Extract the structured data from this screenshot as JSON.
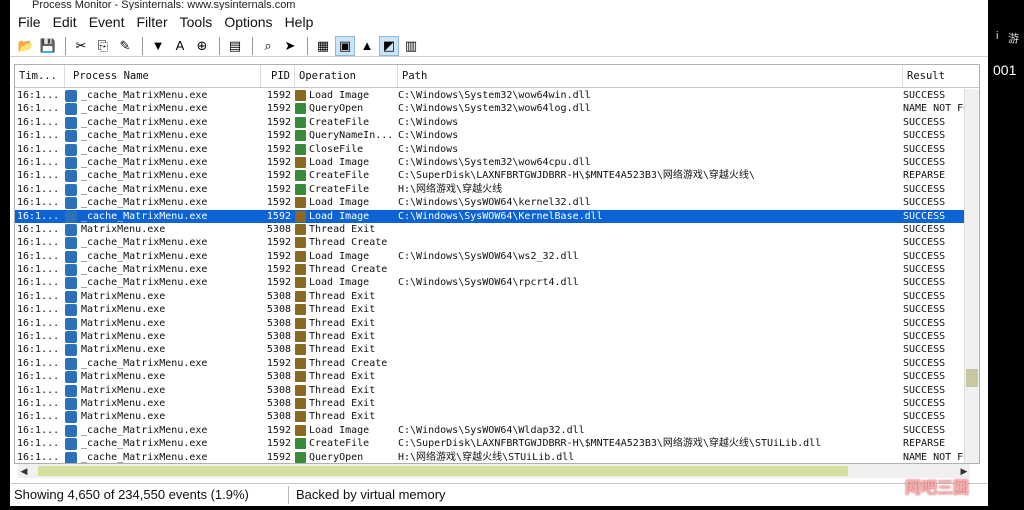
{
  "window": {
    "title": "Process Monitor - Sysinternals: www.sysinternals.com"
  },
  "menu": [
    "File",
    "Edit",
    "Event",
    "Filter",
    "Tools",
    "Options",
    "Help"
  ],
  "toolbar": {
    "buttons": [
      {
        "name": "open-icon",
        "glyph": "📂",
        "pressed": false
      },
      {
        "name": "save-icon",
        "glyph": "💾",
        "pressed": false
      },
      {
        "sep": true
      },
      {
        "name": "capture-icon",
        "glyph": "✂",
        "pressed": false
      },
      {
        "name": "autoscroll-icon",
        "glyph": "⎘",
        "pressed": false
      },
      {
        "name": "clear-icon",
        "glyph": "✎",
        "pressed": false
      },
      {
        "sep": true
      },
      {
        "name": "filter-icon",
        "glyph": "▼",
        "pressed": false
      },
      {
        "name": "highlight-icon",
        "glyph": "A",
        "pressed": false
      },
      {
        "name": "target-icon",
        "glyph": "⊕",
        "pressed": false
      },
      {
        "sep": true
      },
      {
        "name": "process-tree-icon",
        "glyph": "▤",
        "pressed": false
      },
      {
        "sep": true
      },
      {
        "name": "find-icon",
        "glyph": "⌕",
        "pressed": false
      },
      {
        "name": "jump-icon",
        "glyph": "➤",
        "pressed": false
      },
      {
        "sep": true
      },
      {
        "name": "registry-icon",
        "glyph": "▦",
        "pressed": false
      },
      {
        "name": "filesystem-icon",
        "glyph": "▣",
        "pressed": true
      },
      {
        "name": "network-icon",
        "glyph": "▲",
        "pressed": false
      },
      {
        "name": "process-thread-icon",
        "glyph": "◩",
        "pressed": true
      },
      {
        "name": "profiling-icon",
        "glyph": "▥",
        "pressed": false
      }
    ]
  },
  "columns": {
    "time": "Tim...",
    "process": "Process Name",
    "pid": "PID",
    "operation": "Operation",
    "path": "Path",
    "result": "Result"
  },
  "rows": [
    {
      "time": "16:1...",
      "process": "_cache_MatrixMenu.exe",
      "pid": "1592",
      "op": "Load Image",
      "cat": "proc",
      "path": "C:\\Windows\\System32\\wow64win.dll",
      "result": "SUCCESS"
    },
    {
      "time": "16:1...",
      "process": "_cache_MatrixMenu.exe",
      "pid": "1592",
      "op": "QueryOpen",
      "cat": "file",
      "path": "C:\\Windows\\System32\\wow64log.dll",
      "result": "NAME NOT FO"
    },
    {
      "time": "16:1...",
      "process": "_cache_MatrixMenu.exe",
      "pid": "1592",
      "op": "CreateFile",
      "cat": "file",
      "path": "C:\\Windows",
      "result": "SUCCESS"
    },
    {
      "time": "16:1...",
      "process": "_cache_MatrixMenu.exe",
      "pid": "1592",
      "op": "QueryNameIn...",
      "cat": "file",
      "path": "C:\\Windows",
      "result": "SUCCESS"
    },
    {
      "time": "16:1...",
      "process": "_cache_MatrixMenu.exe",
      "pid": "1592",
      "op": "CloseFile",
      "cat": "file",
      "path": "C:\\Windows",
      "result": "SUCCESS"
    },
    {
      "time": "16:1...",
      "process": "_cache_MatrixMenu.exe",
      "pid": "1592",
      "op": "Load Image",
      "cat": "proc",
      "path": "C:\\Windows\\System32\\wow64cpu.dll",
      "result": "SUCCESS"
    },
    {
      "time": "16:1...",
      "process": "_cache_MatrixMenu.exe",
      "pid": "1592",
      "op": "CreateFile",
      "cat": "file",
      "path": "C:\\SuperDisk\\LAXNFBRTGWJDBRR-H\\$MNTE4A523B3\\网络游戏\\穿越火线\\",
      "result": "REPARSE"
    },
    {
      "time": "16:1...",
      "process": "_cache_MatrixMenu.exe",
      "pid": "1592",
      "op": "CreateFile",
      "cat": "file",
      "path": "H:\\网络游戏\\穿越火线",
      "result": "SUCCESS"
    },
    {
      "time": "16:1...",
      "process": "_cache_MatrixMenu.exe",
      "pid": "1592",
      "op": "Load Image",
      "cat": "proc",
      "path": "C:\\Windows\\SysWOW64\\kernel32.dll",
      "result": "SUCCESS"
    },
    {
      "time": "16:1...",
      "process": "_cache_MatrixMenu.exe",
      "pid": "1592",
      "op": "Load Image",
      "cat": "proc",
      "path": "C:\\Windows\\SysWOW64\\KernelBase.dll",
      "result": "SUCCESS",
      "selected": true
    },
    {
      "time": "16:1...",
      "process": "MatrixMenu.exe",
      "pid": "5308",
      "op": "Thread Exit",
      "cat": "proc",
      "path": "",
      "result": "SUCCESS"
    },
    {
      "time": "16:1...",
      "process": "_cache_MatrixMenu.exe",
      "pid": "1592",
      "op": "Thread Create",
      "cat": "proc",
      "path": "",
      "result": "SUCCESS"
    },
    {
      "time": "16:1...",
      "process": "_cache_MatrixMenu.exe",
      "pid": "1592",
      "op": "Load Image",
      "cat": "proc",
      "path": "C:\\Windows\\SysWOW64\\ws2_32.dll",
      "result": "SUCCESS"
    },
    {
      "time": "16:1...",
      "process": "_cache_MatrixMenu.exe",
      "pid": "1592",
      "op": "Thread Create",
      "cat": "proc",
      "path": "",
      "result": "SUCCESS"
    },
    {
      "time": "16:1...",
      "process": "_cache_MatrixMenu.exe",
      "pid": "1592",
      "op": "Load Image",
      "cat": "proc",
      "path": "C:\\Windows\\SysWOW64\\rpcrt4.dll",
      "result": "SUCCESS"
    },
    {
      "time": "16:1...",
      "process": "MatrixMenu.exe",
      "pid": "5308",
      "op": "Thread Exit",
      "cat": "proc",
      "path": "",
      "result": "SUCCESS"
    },
    {
      "time": "16:1...",
      "process": "MatrixMenu.exe",
      "pid": "5308",
      "op": "Thread Exit",
      "cat": "proc",
      "path": "",
      "result": "SUCCESS"
    },
    {
      "time": "16:1...",
      "process": "MatrixMenu.exe",
      "pid": "5308",
      "op": "Thread Exit",
      "cat": "proc",
      "path": "",
      "result": "SUCCESS"
    },
    {
      "time": "16:1...",
      "process": "MatrixMenu.exe",
      "pid": "5308",
      "op": "Thread Exit",
      "cat": "proc",
      "path": "",
      "result": "SUCCESS"
    },
    {
      "time": "16:1...",
      "process": "MatrixMenu.exe",
      "pid": "5308",
      "op": "Thread Exit",
      "cat": "proc",
      "path": "",
      "result": "SUCCESS"
    },
    {
      "time": "16:1...",
      "process": "_cache_MatrixMenu.exe",
      "pid": "1592",
      "op": "Thread Create",
      "cat": "proc",
      "path": "",
      "result": "SUCCESS"
    },
    {
      "time": "16:1...",
      "process": "MatrixMenu.exe",
      "pid": "5308",
      "op": "Thread Exit",
      "cat": "proc",
      "path": "",
      "result": "SUCCESS"
    },
    {
      "time": "16:1...",
      "process": "MatrixMenu.exe",
      "pid": "5308",
      "op": "Thread Exit",
      "cat": "proc",
      "path": "",
      "result": "SUCCESS"
    },
    {
      "time": "16:1...",
      "process": "MatrixMenu.exe",
      "pid": "5308",
      "op": "Thread Exit",
      "cat": "proc",
      "path": "",
      "result": "SUCCESS"
    },
    {
      "time": "16:1...",
      "process": "MatrixMenu.exe",
      "pid": "5308",
      "op": "Thread Exit",
      "cat": "proc",
      "path": "",
      "result": "SUCCESS"
    },
    {
      "time": "16:1...",
      "process": "_cache_MatrixMenu.exe",
      "pid": "1592",
      "op": "Load Image",
      "cat": "proc",
      "path": "C:\\Windows\\SysWOW64\\Wldap32.dll",
      "result": "SUCCESS"
    },
    {
      "time": "16:1...",
      "process": "_cache_MatrixMenu.exe",
      "pid": "1592",
      "op": "CreateFile",
      "cat": "file",
      "path": "C:\\SuperDisk\\LAXNFBRTGWJDBRR-H\\$MNTE4A523B3\\网络游戏\\穿越火线\\STUiLib.dll",
      "result": "REPARSE"
    },
    {
      "time": "16:1...",
      "process": "_cache_MatrixMenu.exe",
      "pid": "1592",
      "op": "QueryOpen",
      "cat": "file",
      "path": "H:\\网络游戏\\穿越火线\\STUiLib.dll",
      "result": "NAME NOT FO"
    }
  ],
  "status": {
    "events": "Showing 4,650 of 234,550 events (1.9%)",
    "memory": "Backed by virtual memory"
  },
  "desktop": {
    "text1": "i",
    "text2": "游",
    "text3": "001",
    "watermark": "网吧三国"
  },
  "colors": {
    "selected_row": "#0b63d6",
    "process_icon": "#2d6fb8",
    "op_file": "#3a8a3a",
    "op_proc": "#8a6a20"
  }
}
